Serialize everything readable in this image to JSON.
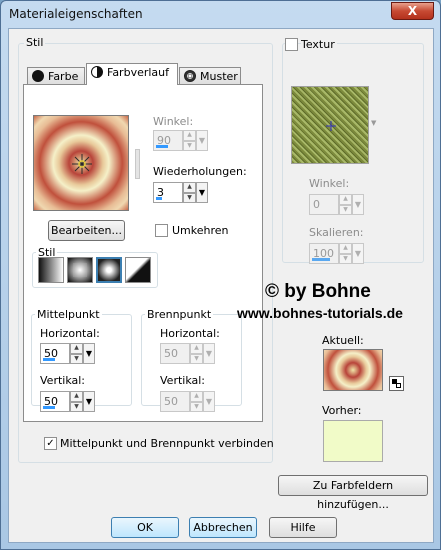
{
  "window": {
    "title": "Materialeigenschaften",
    "close_label": "X"
  },
  "stil": {
    "group_label": "Stil",
    "tabs": [
      {
        "label": "Farbe",
        "icon": "solid-color-icon"
      },
      {
        "label": "Farbverlauf",
        "icon": "gradient-icon"
      },
      {
        "label": "Muster",
        "icon": "pattern-globe-icon"
      }
    ],
    "active_tab": "Farbverlauf",
    "winkel": {
      "label": "Winkel:",
      "value": "90",
      "disabled": true
    },
    "wiederholungen": {
      "label": "Wiederholungen:",
      "value": "3"
    },
    "bearbeiten_label": "Bearbeiten...",
    "umkehren": {
      "label": "Umkehren",
      "checked": false
    },
    "style_group_label": "Stil",
    "style_buttons": [
      "linear-gradient-style",
      "rectangular-gradient-style",
      "sunburst-gradient-style",
      "radial-gradient-style"
    ],
    "selected_style": 2,
    "mittelpunkt": {
      "label": "Mittelpunkt",
      "horizontal_label": "Horizontal:",
      "horizontal": "50",
      "vertikal_label": "Vertikal:",
      "vertikal": "50"
    },
    "brennpunkt": {
      "label": "Brennpunkt",
      "horizontal_label": "Horizontal:",
      "horizontal": "50",
      "vertikal_label": "Vertikal:",
      "vertikal": "50",
      "disabled": true
    },
    "link_checkbox": {
      "label": "Mittelpunkt und Brennpunkt verbinden",
      "checked": true
    }
  },
  "textur": {
    "label": "Textur",
    "checked": false,
    "winkel": {
      "label": "Winkel:",
      "value": "0"
    },
    "skalieren": {
      "label": "Skalieren:",
      "value": "100"
    }
  },
  "watermark": {
    "line1": "© by Bohne",
    "line2": "www.bohnes-tutorials.de"
  },
  "aktuell_label": "Aktuell:",
  "vorher_label": "Vorher:",
  "add_swatch_label": "Zu Farbfeldern hinzufügen...",
  "footer": {
    "ok": "OK",
    "abbrechen": "Abbrechen",
    "hilfe": "Hilfe"
  },
  "colors": {
    "gradient_dark": "#b8443a",
    "gradient_light": "#f5f0c8",
    "vorher_fill": "#f1fbc8",
    "accent": "#3399ff"
  }
}
